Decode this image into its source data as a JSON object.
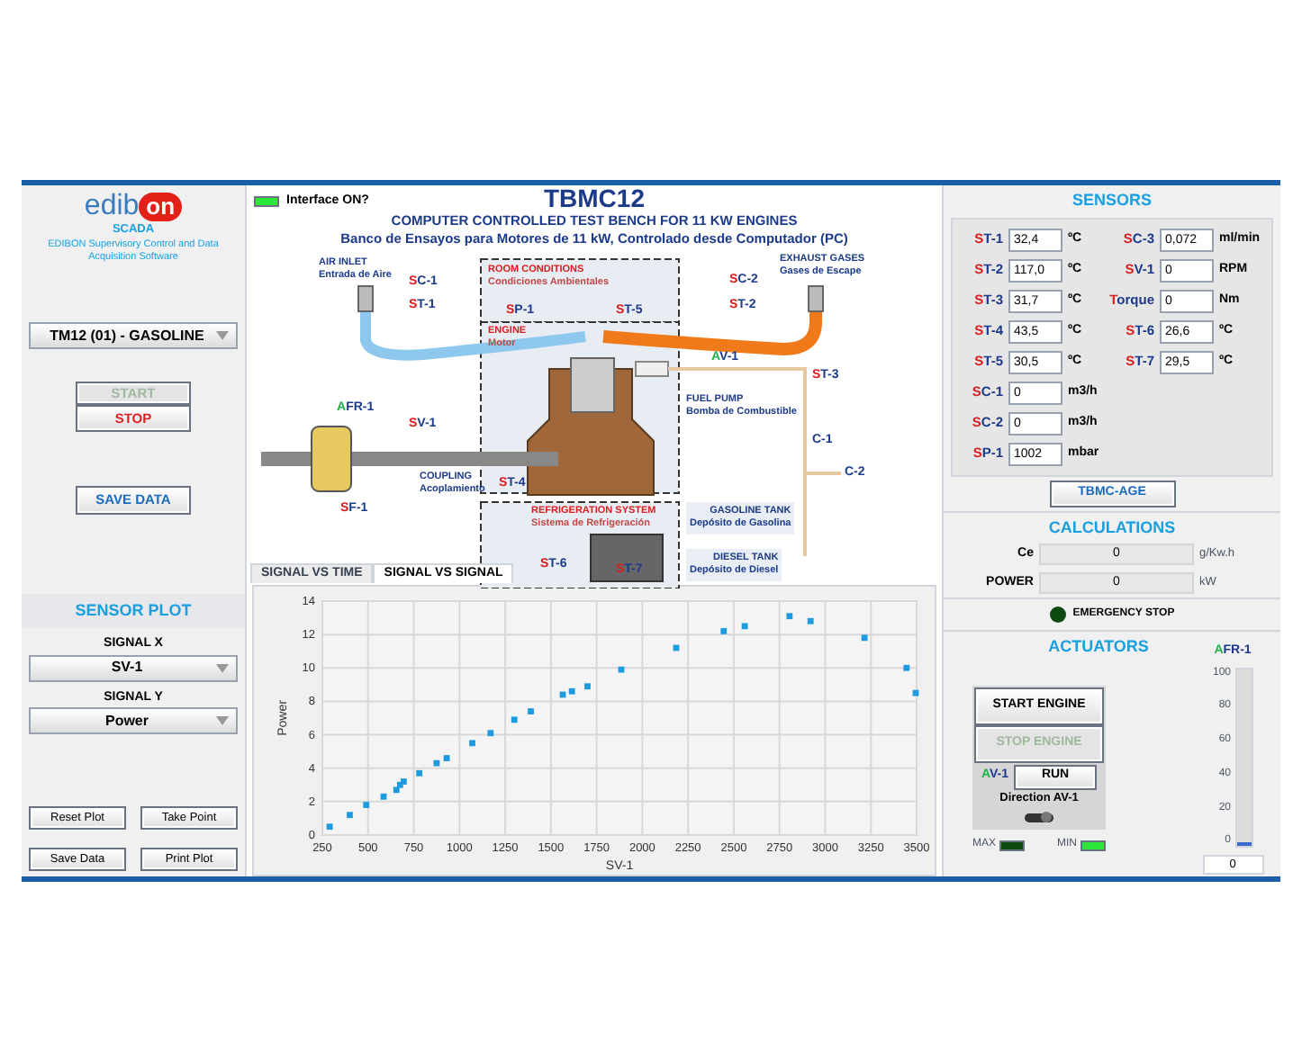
{
  "left_panel": {
    "logo": {
      "text": "edib",
      "badge": "on"
    },
    "product": "SCADA",
    "tagline": "EDIBON Supervisory Control and Data Acquisition Software",
    "unit_select": {
      "value": "TM12 (01) - GASOLINE"
    },
    "start_button": {
      "label": "START",
      "disabled": true
    },
    "stop_button": {
      "label": "STOP",
      "disabled": false
    },
    "save_button": {
      "label": "SAVE DATA"
    },
    "sensor_plot": {
      "title": "SENSOR PLOT",
      "signal_x": {
        "label": "SIGNAL X",
        "value": "SV-1"
      },
      "signal_y": {
        "label": "SIGNAL Y",
        "value": "Power"
      },
      "buttons": [
        "Reset Plot",
        "Take Point",
        "Save Data",
        "Print Plot"
      ]
    }
  },
  "center_panel": {
    "interface_led": {
      "label": "Interface ON?",
      "on": true
    },
    "title": "TBMC12",
    "subtitle": "COMPUTER CONTROLLED TEST BENCH FOR 11 KW ENGINES",
    "subtitle_es": "Banco de Ensayos para Motores de 11 kW, Controlado desde Computador (PC)",
    "diagram_labels": [
      {
        "kind": "caption",
        "title": "AIR INLET",
        "subtitle": "Entrada de Aire"
      },
      {
        "kind": "tag",
        "text": "SC-1"
      },
      {
        "kind": "tag",
        "text": "ST-1"
      },
      {
        "kind": "zone",
        "title": "ROOM CONDITIONS",
        "subtitle": "Condiciones Ambientales"
      },
      {
        "kind": "tag",
        "text": "SP-1"
      },
      {
        "kind": "tag",
        "text": "ST-5"
      },
      {
        "kind": "tag",
        "text": "SC-2"
      },
      {
        "kind": "caption",
        "title": "EXHAUST GASES",
        "subtitle": "Gases de Escape"
      },
      {
        "kind": "tag",
        "text": "ST-2"
      },
      {
        "kind": "zone",
        "title": "ENGINE",
        "subtitle": "Motor"
      },
      {
        "kind": "caption",
        "title": "FUEL PUMP",
        "subtitle": "Bomba de Combustible"
      },
      {
        "kind": "actuator",
        "text": "AV-1"
      },
      {
        "kind": "tag",
        "text": "ST-3"
      },
      {
        "kind": "actuator",
        "text": "AFR-1"
      },
      {
        "kind": "tag",
        "text": "SV-1"
      },
      {
        "kind": "plain",
        "text": "C-1"
      },
      {
        "kind": "caption",
        "title": "COUPLING",
        "subtitle": "Acoplamiento"
      },
      {
        "kind": "tag",
        "text": "ST-4"
      },
      {
        "kind": "plain",
        "text": "C-2"
      },
      {
        "kind": "tag",
        "text": "SF-1"
      },
      {
        "kind": "zone",
        "title": "REFRIGERATION SYSTEM",
        "subtitle": "Sistema de Refrigeración"
      },
      {
        "kind": "tank",
        "title": "GASOLINE TANK",
        "subtitle": "Depósito de Gasolina"
      },
      {
        "kind": "tag",
        "text": "ST-6"
      },
      {
        "kind": "tag",
        "text": "ST-7"
      },
      {
        "kind": "tank",
        "title": "DIESEL TANK",
        "subtitle": "Depósito de Diesel"
      }
    ],
    "tabs": [
      {
        "label": "SIGNAL VS TIME",
        "selected": false
      },
      {
        "label": "SIGNAL VS SIGNAL",
        "selected": true
      }
    ],
    "chart_data": {
      "type": "scatter",
      "xlabel": "SV-1",
      "ylabel": "Power",
      "x": [
        290,
        400,
        490,
        585,
        655,
        675,
        695,
        780,
        875,
        930,
        1070,
        1170,
        1300,
        1390,
        1565,
        1615,
        1700,
        1885,
        2185,
        2445,
        2560,
        2805,
        2920,
        3215,
        3445,
        3495
      ],
      "grid": true,
      "series": [
        {
          "color": "#1e9be0",
          "values": [
            0.5,
            1.2,
            1.8,
            2.3,
            2.7,
            3.0,
            3.2,
            3.7,
            4.3,
            4.6,
            5.5,
            6.1,
            6.9,
            7.4,
            8.4,
            8.6,
            8.9,
            9.9,
            11.2,
            12.2,
            12.5,
            13.1,
            12.8,
            11.8,
            10.0,
            8.5
          ]
        }
      ],
      "xlim": [
        250,
        3500
      ],
      "ylim": [
        0,
        14
      ],
      "xticks": [
        250,
        500,
        750,
        1000,
        1250,
        1500,
        1750,
        2000,
        2250,
        2500,
        2750,
        3000,
        3250,
        3500
      ],
      "yticks": [
        0,
        2,
        4,
        6,
        8,
        10,
        12,
        14
      ]
    }
  },
  "right_panel": {
    "sensors_title": "SENSORS",
    "sensors_left": [
      {
        "label": "ST-1",
        "value": "32,4",
        "unit": "ºC"
      },
      {
        "label": "ST-2",
        "value": "117,0",
        "unit": "ºC"
      },
      {
        "label": "ST-3",
        "value": "31,7",
        "unit": "ºC"
      },
      {
        "label": "ST-4",
        "value": "43,5",
        "unit": "ºC"
      },
      {
        "label": "ST-5",
        "value": "30,5",
        "unit": "ºC"
      },
      {
        "label": "SC-1",
        "value": "0",
        "unit": "m3/h"
      },
      {
        "label": "SC-2",
        "value": "0",
        "unit": "m3/h"
      },
      {
        "label": "SP-1",
        "value": "1002",
        "unit": "mbar"
      }
    ],
    "sensors_right": [
      {
        "label": "SC-3",
        "value": "0,072",
        "unit": "ml/min"
      },
      {
        "label": "SV-1",
        "value": "0",
        "unit": "RPM"
      },
      {
        "label": "Torque",
        "value": "0",
        "unit": "Nm"
      },
      {
        "label": "ST-6",
        "value": "26,6",
        "unit": "ºC"
      },
      {
        "label": "ST-7",
        "value": "29,5",
        "unit": "ºC"
      }
    ],
    "age_button": "TBMC-AGE",
    "calculations_title": "CALCULATIONS",
    "calculations": [
      {
        "label": "Ce",
        "value": "0",
        "unit": "g/Kw.h"
      },
      {
        "label": "POWER",
        "value": "0",
        "unit": "kW"
      }
    ],
    "emergency_stop": {
      "label": "EMERGENCY STOP",
      "on": false
    },
    "actuators_title": "ACTUATORS",
    "start_engine": {
      "label": "START ENGINE",
      "disabled": false
    },
    "stop_engine": {
      "label": "STOP ENGINE",
      "disabled": true
    },
    "av1": {
      "label": "AV-1",
      "button": "RUN",
      "direction_label": "Direction AV-1"
    },
    "max_led": {
      "label": "MAX",
      "on": false
    },
    "min_led": {
      "label": "MIN",
      "on": true
    },
    "afr_slider": {
      "label": "AFR-1",
      "ticks": [
        "100",
        "80",
        "60",
        "40",
        "20",
        "0"
      ],
      "level": 0,
      "value": "0"
    }
  }
}
